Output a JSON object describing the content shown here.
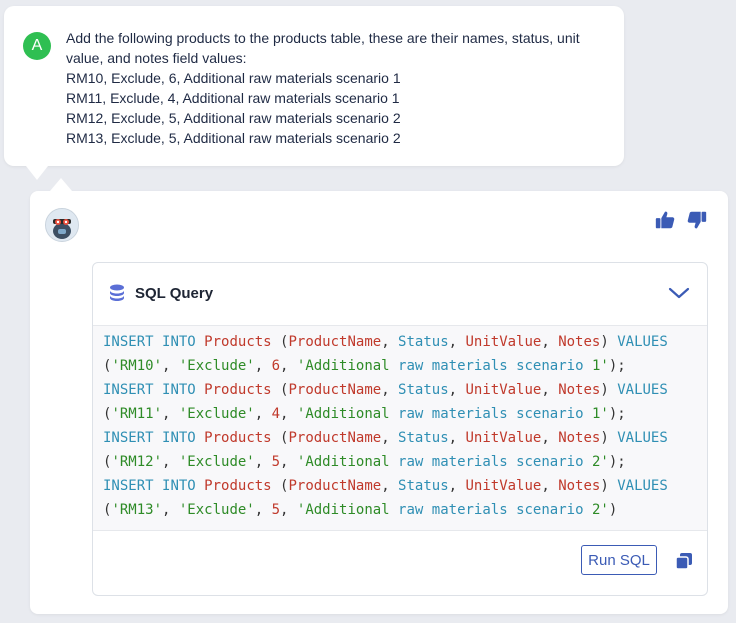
{
  "user_message": {
    "avatar_letter": "A",
    "lines": [
      "Add the following products to the products table, these are their names, status, unit",
      "value, and notes field values:",
      "RM10, Exclude, 6, Additional raw materials scenario 1",
      "RM11, Exclude, 4, Additional raw materials scenario 1",
      "RM12, Exclude, 5, Additional raw materials scenario 2",
      "RM13, Exclude, 5, Additional raw materials scenario 2"
    ]
  },
  "assistant": {
    "panel_title": "SQL Query",
    "run_button_label": "Run SQL",
    "statements": [
      {
        "kw1": "INSERT",
        "kw2": "INTO",
        "table": "Products",
        "c1": "ProductName",
        "c2": "Status",
        "c3": "UnitValue",
        "c4": "Notes",
        "kw3": "VALUES",
        "v1": "'RM10'",
        "v2": "'Exclude'",
        "v3": "6",
        "v4": "'Additional raw materials scenario 1'",
        "end": ");"
      },
      {
        "kw1": "INSERT",
        "kw2": "INTO",
        "table": "Products",
        "c1": "ProductName",
        "c2": "Status",
        "c3": "UnitValue",
        "c4": "Notes",
        "kw3": "VALUES",
        "v1": "'RM11'",
        "v2": "'Exclude'",
        "v3": "4",
        "v4": "'Additional raw materials scenario 1'",
        "end": ");"
      },
      {
        "kw1": "INSERT",
        "kw2": "INTO",
        "table": "Products",
        "c1": "ProductName",
        "c2": "Status",
        "c3": "UnitValue",
        "c4": "Notes",
        "kw3": "VALUES",
        "v1": "'RM12'",
        "v2": "'Exclude'",
        "v3": "5",
        "v4": "'Additional raw materials scenario 2'",
        "end": ");"
      },
      {
        "kw1": "INSERT",
        "kw2": "INTO",
        "table": "Products",
        "c1": "ProductName",
        "c2": "Status",
        "c3": "UnitValue",
        "c4": "Notes",
        "kw3": "VALUES",
        "v1": "'RM13'",
        "v2": "'Exclude'",
        "v3": "5",
        "v4": "'Additional raw materials scenario 2'",
        "end": ")"
      }
    ]
  },
  "icons": {
    "thumbs_up": "thumbs-up-icon",
    "thumbs_down": "thumbs-down-icon",
    "database": "database-icon",
    "chevron": "chevron-down-icon",
    "copy": "copy-icon"
  },
  "colors": {
    "accent": "#3b5bb5",
    "user_avatar": "#2fbf52",
    "keyword": "#2f8fb4",
    "identifier": "#c0392b",
    "string": "#2e8b27"
  }
}
